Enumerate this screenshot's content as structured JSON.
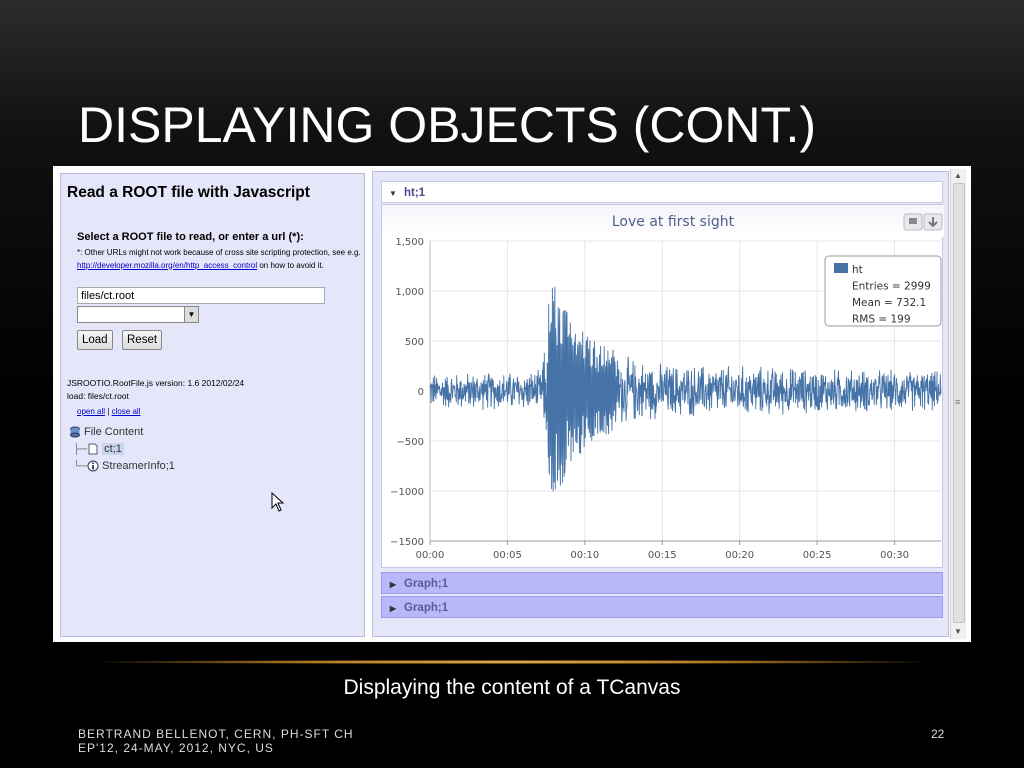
{
  "slide": {
    "title": "DISPLAYING OBJECTS (CONT.)",
    "caption": "Displaying the content of a TCanvas",
    "footer_line1": "BERTRAND BELLENOT, CERN, PH-SFT CH",
    "footer_line2": "EP'12, 24-MAY, 2012, NYC, US",
    "page_number": "22"
  },
  "left_panel": {
    "title": "Read a ROOT file with Javascript",
    "subtitle": "Select a ROOT file to read, or enter a url (*):",
    "note_prefix": "*: Other URLs might not work because of cross site scripting protection, see e.g. ",
    "note_link": "http://developer.mozilla.org/en/http_access_control",
    "note_suffix": " on how to avoid it.",
    "file_input_value": "files/ct.root",
    "load_label": "Load",
    "reset_label": "Reset",
    "version_line": "JSROOTIO.RootFile.js version: 1.6 2012/02/24",
    "load_line": "load: files/ct.root",
    "open_all": "open all",
    "separator": "|",
    "close_all": "close all",
    "tree": {
      "root": "File Content",
      "items": [
        "ct;1",
        "StreamerInfo;1"
      ]
    }
  },
  "right_panel": {
    "header_ht": "ht;1",
    "header_graph1": "Graph;1",
    "header_graph2": "Graph;1"
  },
  "chart_data": {
    "type": "line",
    "title": "Love at first sight",
    "xlabel": "",
    "ylabel": "",
    "ylim": [
      -1500,
      1500
    ],
    "xlim": [
      0,
      33
    ],
    "x_unit": "seconds",
    "x_ticks": [
      "00:00",
      "00:05",
      "00:10",
      "00:15",
      "00:20",
      "00:25",
      "00:30"
    ],
    "y_ticks": [
      "1,500",
      "1,000",
      "500",
      "0",
      "−500",
      "−1000",
      "−1500"
    ],
    "y_tick_values": [
      1500,
      1000,
      500,
      0,
      -500,
      -1000,
      -1500
    ],
    "grid": true,
    "legend": {
      "placement": "top-right",
      "name": "ht",
      "entries": "Entries = 2999",
      "mean": "Mean = 732.1",
      "rms": "RMS = 199"
    },
    "series_color": "#4572a7",
    "envelope": {
      "description_points": [
        {
          "x": 0,
          "amp": 200
        },
        {
          "x": 7.2,
          "amp": 220
        },
        {
          "x": 7.8,
          "amp": 1100
        },
        {
          "x": 8.2,
          "amp": 1050
        },
        {
          "x": 9,
          "amp": 800
        },
        {
          "x": 10,
          "amp": 600
        },
        {
          "x": 12,
          "amp": 400
        },
        {
          "x": 15,
          "amp": 300
        },
        {
          "x": 20,
          "amp": 280
        },
        {
          "x": 25,
          "amp": 250
        },
        {
          "x": 33,
          "amp": 220
        }
      ]
    }
  }
}
